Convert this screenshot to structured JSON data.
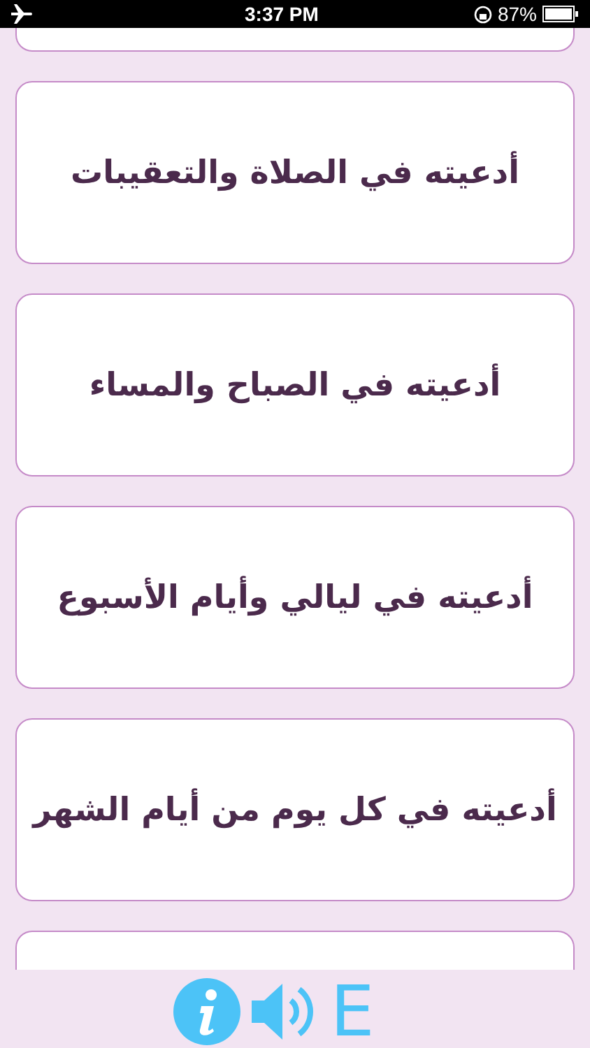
{
  "status_bar": {
    "time": "3:37 PM",
    "battery": "87%"
  },
  "items": [
    {
      "label": "أدعيته في الصلاة والتعقيبات"
    },
    {
      "label": "أدعيته في الصباح والمساء"
    },
    {
      "label": "أدعيته في ليالي وأيام الأسبوع"
    },
    {
      "label": "أدعيته في كل يوم من أيام الشهر"
    }
  ],
  "toolbar": {
    "language": "E"
  }
}
